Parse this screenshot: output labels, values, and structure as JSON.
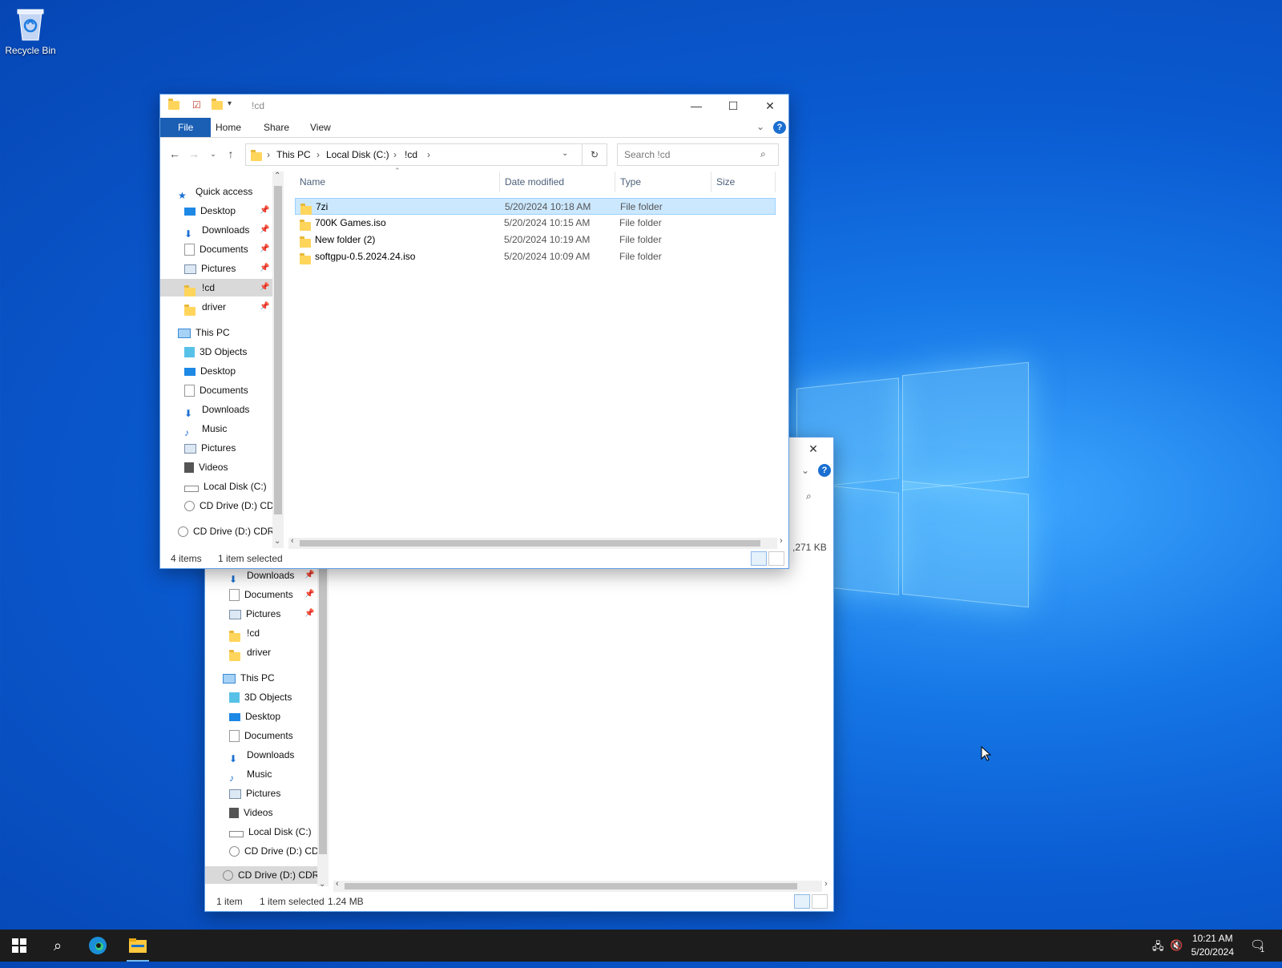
{
  "desktop": {
    "recycle_bin_label": "Recycle Bin"
  },
  "front_window": {
    "title": "!cd",
    "ribbon_tabs": [
      "File",
      "Home",
      "Share",
      "View"
    ],
    "breadcrumb": [
      "This PC",
      "Local Disk (C:)",
      "!cd"
    ],
    "search_placeholder": "Search !cd",
    "nav": {
      "quick_access": "Quick access",
      "quick_items": [
        "Desktop",
        "Downloads",
        "Documents",
        "Pictures",
        "!cd",
        "driver"
      ],
      "this_pc": "This PC",
      "pc_items": [
        "3D Objects",
        "Desktop",
        "Documents",
        "Downloads",
        "Music",
        "Pictures",
        "Videos",
        "Local Disk (C:)",
        "CD Drive (D:) CD"
      ],
      "cd_drive": "CD Drive (D:) CDR"
    },
    "columns": [
      "Name",
      "Date modified",
      "Type",
      "Size"
    ],
    "files": [
      {
        "name": "7zi",
        "date": "5/20/2024 10:18 AM",
        "type": "File folder",
        "size": ""
      },
      {
        "name": "700K Games.iso",
        "date": "5/20/2024 10:15 AM",
        "type": "File folder",
        "size": ""
      },
      {
        "name": "New folder (2)",
        "date": "5/20/2024 10:19 AM",
        "type": "File folder",
        "size": ""
      },
      {
        "name": "softgpu-0.5.2024.24.iso",
        "date": "5/20/2024 10:09 AM",
        "type": "File folder",
        "size": ""
      }
    ],
    "status": {
      "items": "4 items",
      "selected": "1 item selected"
    }
  },
  "back_window": {
    "size_fragment": ",271 KB",
    "nav_items": [
      "Downloads",
      "Documents",
      "Pictures",
      "!cd",
      "driver"
    ],
    "this_pc": "This PC",
    "pc_items": [
      "3D Objects",
      "Desktop",
      "Documents",
      "Downloads",
      "Music",
      "Pictures",
      "Videos",
      "Local Disk (C:)",
      "CD Drive (D:) CD"
    ],
    "cd_drive": "CD Drive (D:) CDR",
    "status": {
      "items": "1 item",
      "selected": "1 item selected",
      "size": "1.24 MB"
    }
  },
  "taskbar": {
    "time": "10:21 AM",
    "date": "5/20/2024",
    "notification_count": "1"
  },
  "colors": {
    "accent": "#1a5fb4",
    "selection": "#cce8ff",
    "taskbar": "#1c1c1c"
  }
}
